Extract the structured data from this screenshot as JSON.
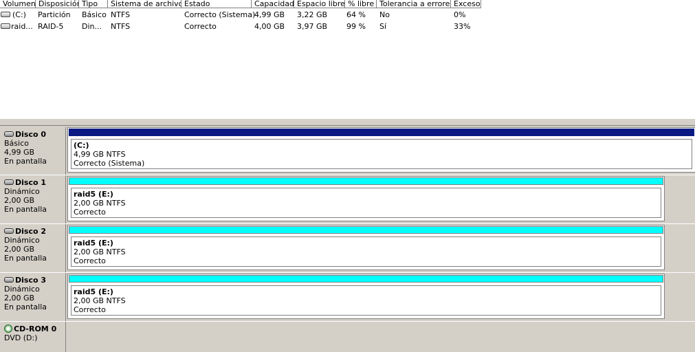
{
  "volume_list": {
    "columns": [
      "Volumen",
      "Disposición",
      "Tipo",
      "Sistema de archivos",
      "Estado",
      "Capacidad",
      "Espacio libre",
      "% libre",
      "Tolerancia a errores",
      "Exceso"
    ],
    "rows": [
      {
        "volume": "(C:)",
        "layout": "Partición",
        "type": "Básico",
        "fs": "NTFS",
        "status": "Correcto (Sistema)",
        "capacity": "4,99 GB",
        "free": "3,22 GB",
        "pct_free": "64 %",
        "fault_tolerance": "No",
        "overhead": "0%"
      },
      {
        "volume": "raid...",
        "layout": "RAID-5",
        "type": "Din...",
        "fs": "NTFS",
        "status": "Correcto",
        "capacity": "4,00 GB",
        "free": "3,97 GB",
        "pct_free": "99 %",
        "fault_tolerance": "Sí",
        "overhead": "33%"
      }
    ]
  },
  "disks": [
    {
      "name": "Disco 0",
      "type": "Básico",
      "size": "4,99 GB",
      "state": "En pantalla",
      "partition": {
        "title": "(C:)",
        "size_fs": "4,99 GB NTFS",
        "status": "Correcto (Sistema)",
        "bar_color": "#0a1a82"
      }
    },
    {
      "name": "Disco 1",
      "type": "Dinámico",
      "size": "2,00 GB",
      "state": "En pantalla",
      "partition": {
        "title": "raid5  (E:)",
        "size_fs": "2,00 GB NTFS",
        "status": "Correcto",
        "bar_color": "#00ffff"
      }
    },
    {
      "name": "Disco 2",
      "type": "Dinámico",
      "size": "2,00 GB",
      "state": "En pantalla",
      "partition": {
        "title": "raid5  (E:)",
        "size_fs": "2,00 GB NTFS",
        "status": "Correcto",
        "bar_color": "#00ffff"
      }
    },
    {
      "name": "Disco 3",
      "type": "Dinámico",
      "size": "2,00 GB",
      "state": "En pantalla",
      "partition": {
        "title": "raid5  (E:)",
        "size_fs": "2,00 GB NTFS",
        "status": "Correcto",
        "bar_color": "#00ffff"
      }
    }
  ],
  "cdrom": {
    "name": "CD-ROM 0",
    "drive": "DVD (D:)"
  }
}
